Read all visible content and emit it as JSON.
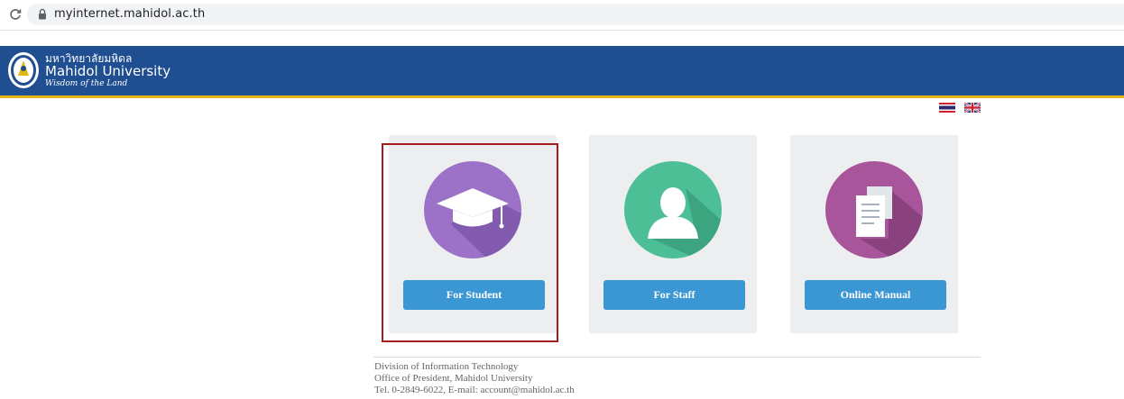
{
  "browser": {
    "url": "myinternet.mahidol.ac.th"
  },
  "header": {
    "logo_thai": "มหาวิทยาลัยมหิดล",
    "logo_en": "Mahidol University",
    "logo_motto": "Wisdom of the Land",
    "bg_color": "#1f4e91",
    "accent_color": "#e4b713"
  },
  "languages": [
    {
      "code": "th",
      "icon": "thai-flag-icon"
    },
    {
      "code": "en",
      "icon": "uk-flag-icon"
    }
  ],
  "cards": [
    {
      "id": "student",
      "label": "For Student",
      "icon": "graduation-cap-icon",
      "circle_color": "#9b72c8",
      "highlighted": true
    },
    {
      "id": "staff",
      "label": "For Staff",
      "icon": "user-silhouette-icon",
      "circle_color": "#4dbf97"
    },
    {
      "id": "manual",
      "label": "Online Manual",
      "icon": "document-icon",
      "circle_color": "#a8559c"
    }
  ],
  "button_color": "#3b97d3",
  "highlight_color": "#a61c1c",
  "footer": {
    "line1": "Division of Information Technology",
    "line2": "Office of President, Mahidol University",
    "line3": "Tel. 0-2849-6022, E-mail: account@mahidol.ac.th"
  }
}
